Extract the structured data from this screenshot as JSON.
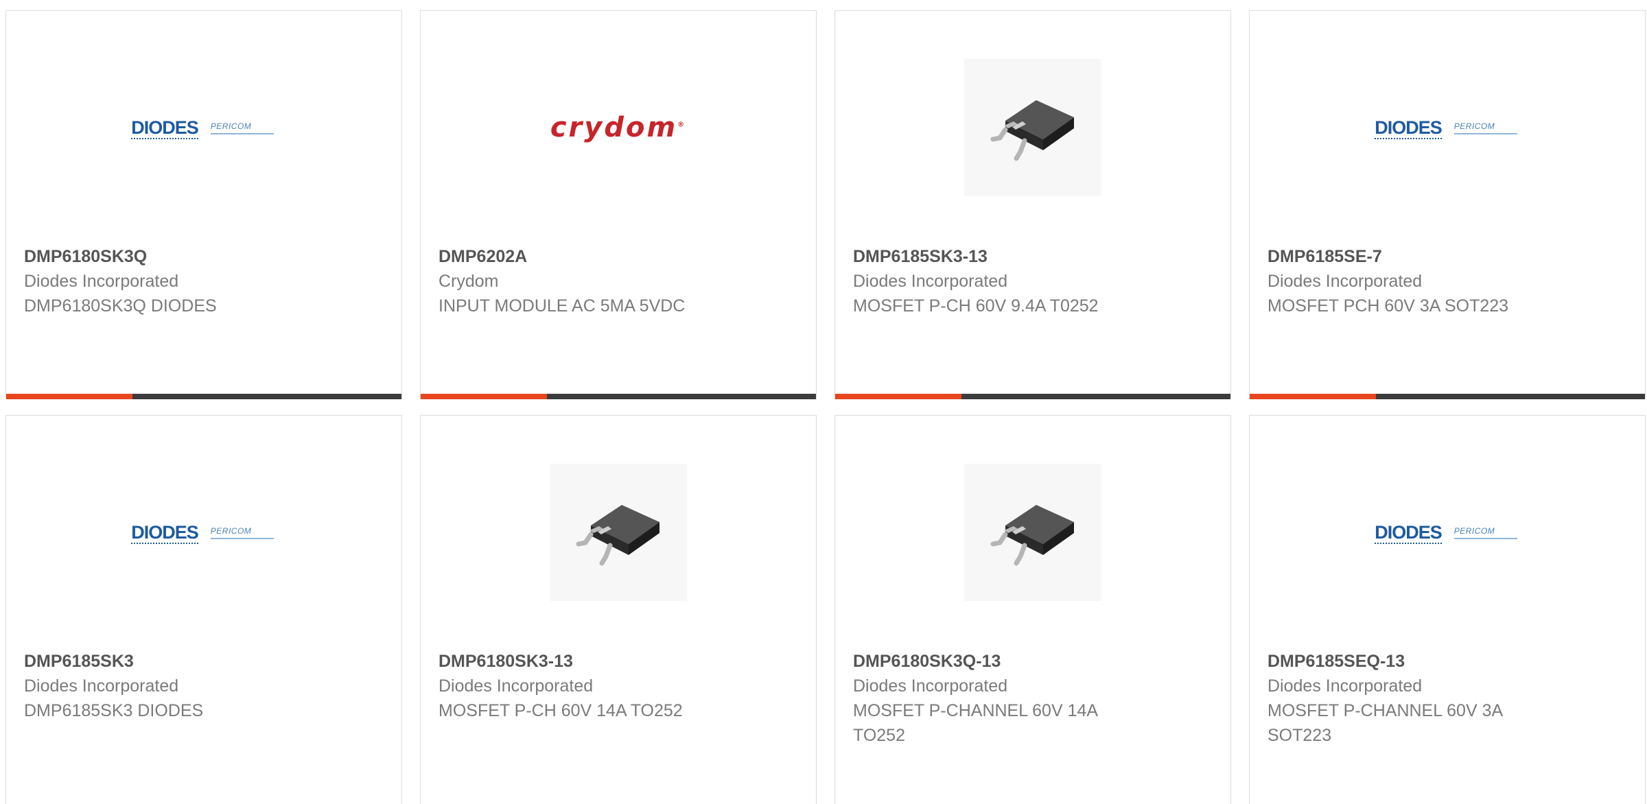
{
  "brand_colors": {
    "accent": "#e8461f",
    "track": "#3c3c3c",
    "diodes_blue": "#1e5aa0",
    "crydom_red": "#c8242b"
  },
  "logos": {
    "diodes": "DIODES",
    "pericom": "PERICOM",
    "crydom": "crydom"
  },
  "products": [
    {
      "part_number": "DMP6180SK3Q",
      "manufacturer": "Diodes Incorporated",
      "description": "DMP6180SK3Q DIODES",
      "image": "diodes-pericom-logo",
      "progress": 0.32
    },
    {
      "part_number": "DMP6202A",
      "manufacturer": "Crydom",
      "description": "INPUT MODULE AC 5MA 5VDC",
      "image": "crydom-logo",
      "progress": 0.32
    },
    {
      "part_number": "DMP6185SK3-13",
      "manufacturer": "Diodes Incorporated",
      "description": "MOSFET P-CH 60V 9.4A T0252",
      "image": "to252-chip-icon",
      "progress": 0.32
    },
    {
      "part_number": "DMP6185SE-7",
      "manufacturer": "Diodes Incorporated",
      "description": "MOSFET PCH 60V 3A SOT223",
      "image": "diodes-pericom-logo",
      "progress": 0.32
    },
    {
      "part_number": "DMP6185SK3",
      "manufacturer": "Diodes Incorporated",
      "description": "DMP6185SK3 DIODES",
      "image": "diodes-pericom-logo"
    },
    {
      "part_number": "DMP6180SK3-13",
      "manufacturer": "Diodes Incorporated",
      "description": "MOSFET P-CH 60V 14A TO252",
      "image": "to252-chip-icon"
    },
    {
      "part_number": "DMP6180SK3Q-13",
      "manufacturer": "Diodes Incorporated",
      "description": "MOSFET P-CHANNEL 60V 14A TO252",
      "image": "to252-chip-icon"
    },
    {
      "part_number": "DMP6185SEQ-13",
      "manufacturer": "Diodes Incorporated",
      "description": "MOSFET P-CHANNEL 60V 3A SOT223",
      "image": "diodes-pericom-logo"
    }
  ]
}
